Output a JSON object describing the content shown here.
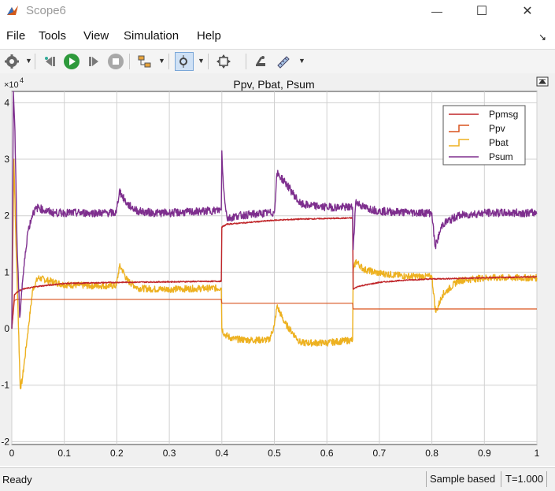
{
  "window": {
    "title": "Scope6",
    "minimize_label": "—",
    "maximize_label": "☐",
    "close_label": "✕"
  },
  "menu": {
    "items": [
      "File",
      "Tools",
      "View",
      "Simulation",
      "Help"
    ],
    "dock_label": "↘"
  },
  "toolbar": {
    "buttons": [
      "settings-icon",
      "step-back-icon",
      "run-icon",
      "step-forward-icon",
      "stop-icon",
      "signal-select-icon",
      "zoom-icon",
      "fit-view-icon",
      "highlight-block-icon",
      "measurement-icon"
    ]
  },
  "colors": {
    "ppmsg": "#c0262a",
    "ppv": "#d9541e",
    "pbat": "#edb120",
    "psum": "#7e2f8e",
    "plot_bg": "#ffffff",
    "grid": "#d0d0d0"
  },
  "chart_data": {
    "type": "line",
    "title": "Ppv, Pbat, Psum",
    "exponent_label": "×10",
    "exponent_power": "4",
    "xlim": [
      0,
      1
    ],
    "ylim": [
      -2.05,
      4.2
    ],
    "x_ticks": [
      "0",
      "0.1",
      "0.2",
      "0.3",
      "0.4",
      "0.5",
      "0.6",
      "0.7",
      "0.8",
      "0.9",
      "1"
    ],
    "y_ticks": [
      "-2",
      "-1",
      "0",
      "1",
      "2",
      "3",
      "4"
    ],
    "y_tick_values": [
      -2,
      -1,
      0,
      1,
      2,
      3,
      4
    ],
    "x_tick_values": [
      0,
      0.1,
      0.2,
      0.3,
      0.4,
      0.5,
      0.6,
      0.7,
      0.8,
      0.9,
      1
    ],
    "legend_position": "top-right",
    "series": [
      {
        "name": "Ppmsg",
        "color": "#c0262a",
        "x": [
          0,
          0.005,
          0.01,
          0.02,
          0.05,
          0.1,
          0.2,
          0.3,
          0.399,
          0.4,
          0.41,
          0.45,
          0.5,
          0.55,
          0.6,
          0.649,
          0.65,
          0.66,
          0.7,
          0.75,
          0.8,
          0.9,
          1.0
        ],
        "y": [
          0,
          0.6,
          0.65,
          0.7,
          0.75,
          0.8,
          0.82,
          0.83,
          0.84,
          1.8,
          1.85,
          1.88,
          1.92,
          1.94,
          1.95,
          1.96,
          0.7,
          0.75,
          0.82,
          0.86,
          0.88,
          0.9,
          0.92
        ]
      },
      {
        "name": "Ppv",
        "color": "#d9541e",
        "x": [
          0,
          0.005,
          0.01,
          0.399,
          0.4,
          0.649,
          0.65,
          1.0
        ],
        "y": [
          0,
          0.5,
          0.52,
          0.52,
          0.45,
          0.45,
          0.35,
          0.35
        ]
      },
      {
        "name": "Pbat",
        "color": "#edb120",
        "x": [
          0,
          0.004,
          0.008,
          0.012,
          0.016,
          0.02,
          0.03,
          0.04,
          0.05,
          0.07,
          0.1,
          0.15,
          0.199,
          0.205,
          0.21,
          0.22,
          0.24,
          0.27,
          0.3,
          0.35,
          0.399,
          0.4,
          0.405,
          0.42,
          0.45,
          0.49,
          0.5,
          0.505,
          0.52,
          0.55,
          0.6,
          0.649,
          0.65,
          0.655,
          0.67,
          0.7,
          0.75,
          0.8,
          0.807,
          0.81,
          0.82,
          0.85,
          0.9,
          0.95,
          1.0
        ],
        "y": [
          0,
          3.0,
          1.5,
          0.3,
          -1.05,
          -0.9,
          -0.1,
          0.7,
          0.9,
          0.85,
          0.78,
          0.76,
          0.76,
          1.1,
          1.05,
          0.85,
          0.72,
          0.7,
          0.7,
          0.71,
          0.72,
          0.0,
          -0.1,
          -0.18,
          -0.2,
          -0.2,
          0.05,
          0.4,
          0.1,
          -0.25,
          -0.25,
          -0.2,
          1.0,
          1.2,
          1.05,
          0.98,
          0.93,
          0.92,
          0.3,
          0.35,
          0.6,
          0.85,
          0.9,
          0.9,
          0.9
        ]
      },
      {
        "name": "Psum",
        "color": "#7e2f8e",
        "x": [
          0,
          0.003,
          0.006,
          0.01,
          0.015,
          0.02,
          0.03,
          0.04,
          0.05,
          0.06,
          0.08,
          0.1,
          0.15,
          0.199,
          0.205,
          0.21,
          0.22,
          0.24,
          0.27,
          0.3,
          0.35,
          0.399,
          0.4,
          0.403,
          0.41,
          0.43,
          0.49,
          0.5,
          0.505,
          0.52,
          0.55,
          0.6,
          0.649,
          0.65,
          0.655,
          0.67,
          0.7,
          0.75,
          0.8,
          0.806,
          0.81,
          0.82,
          0.85,
          0.9,
          0.95,
          1.0
        ],
        "y": [
          0,
          4.2,
          3.5,
          1.5,
          0.2,
          0.8,
          1.7,
          2.05,
          2.15,
          2.1,
          2.05,
          2.05,
          2.05,
          2.05,
          2.45,
          2.35,
          2.2,
          2.08,
          2.05,
          2.05,
          2.07,
          2.1,
          3.15,
          2.5,
          1.95,
          2.0,
          2.05,
          2.05,
          2.75,
          2.6,
          2.2,
          2.15,
          2.15,
          1.4,
          2.25,
          2.15,
          2.08,
          2.06,
          2.05,
          1.45,
          1.55,
          1.85,
          2.0,
          2.05,
          2.05,
          2.05
        ]
      }
    ]
  },
  "status": {
    "left": "Ready",
    "sample_mode": "Sample based",
    "time": "T=1.000"
  }
}
